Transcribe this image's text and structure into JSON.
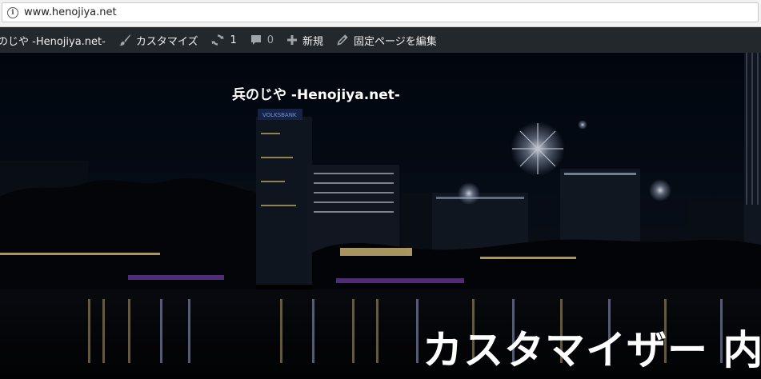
{
  "browser": {
    "url": "www.henojiya.net",
    "info_icon": "ⓘ"
  },
  "adminbar": {
    "site_name": "兵のじや -Henojiya.net-",
    "customize_label": "カスタマイズ",
    "updates_count": "1",
    "comments_count": "0",
    "new_label": "新規",
    "edit_page_label": "固定ページを編集",
    "icons": [
      "brush-icon",
      "updates-icon",
      "comment-icon",
      "plus-icon",
      "pencil-icon"
    ],
    "bg_color": "#23282d",
    "icon_color": "#a0a5aa"
  },
  "hero": {
    "site_title": "兵のじや -Henojiya.net-",
    "page_heading": "カスタマイザー 内"
  }
}
